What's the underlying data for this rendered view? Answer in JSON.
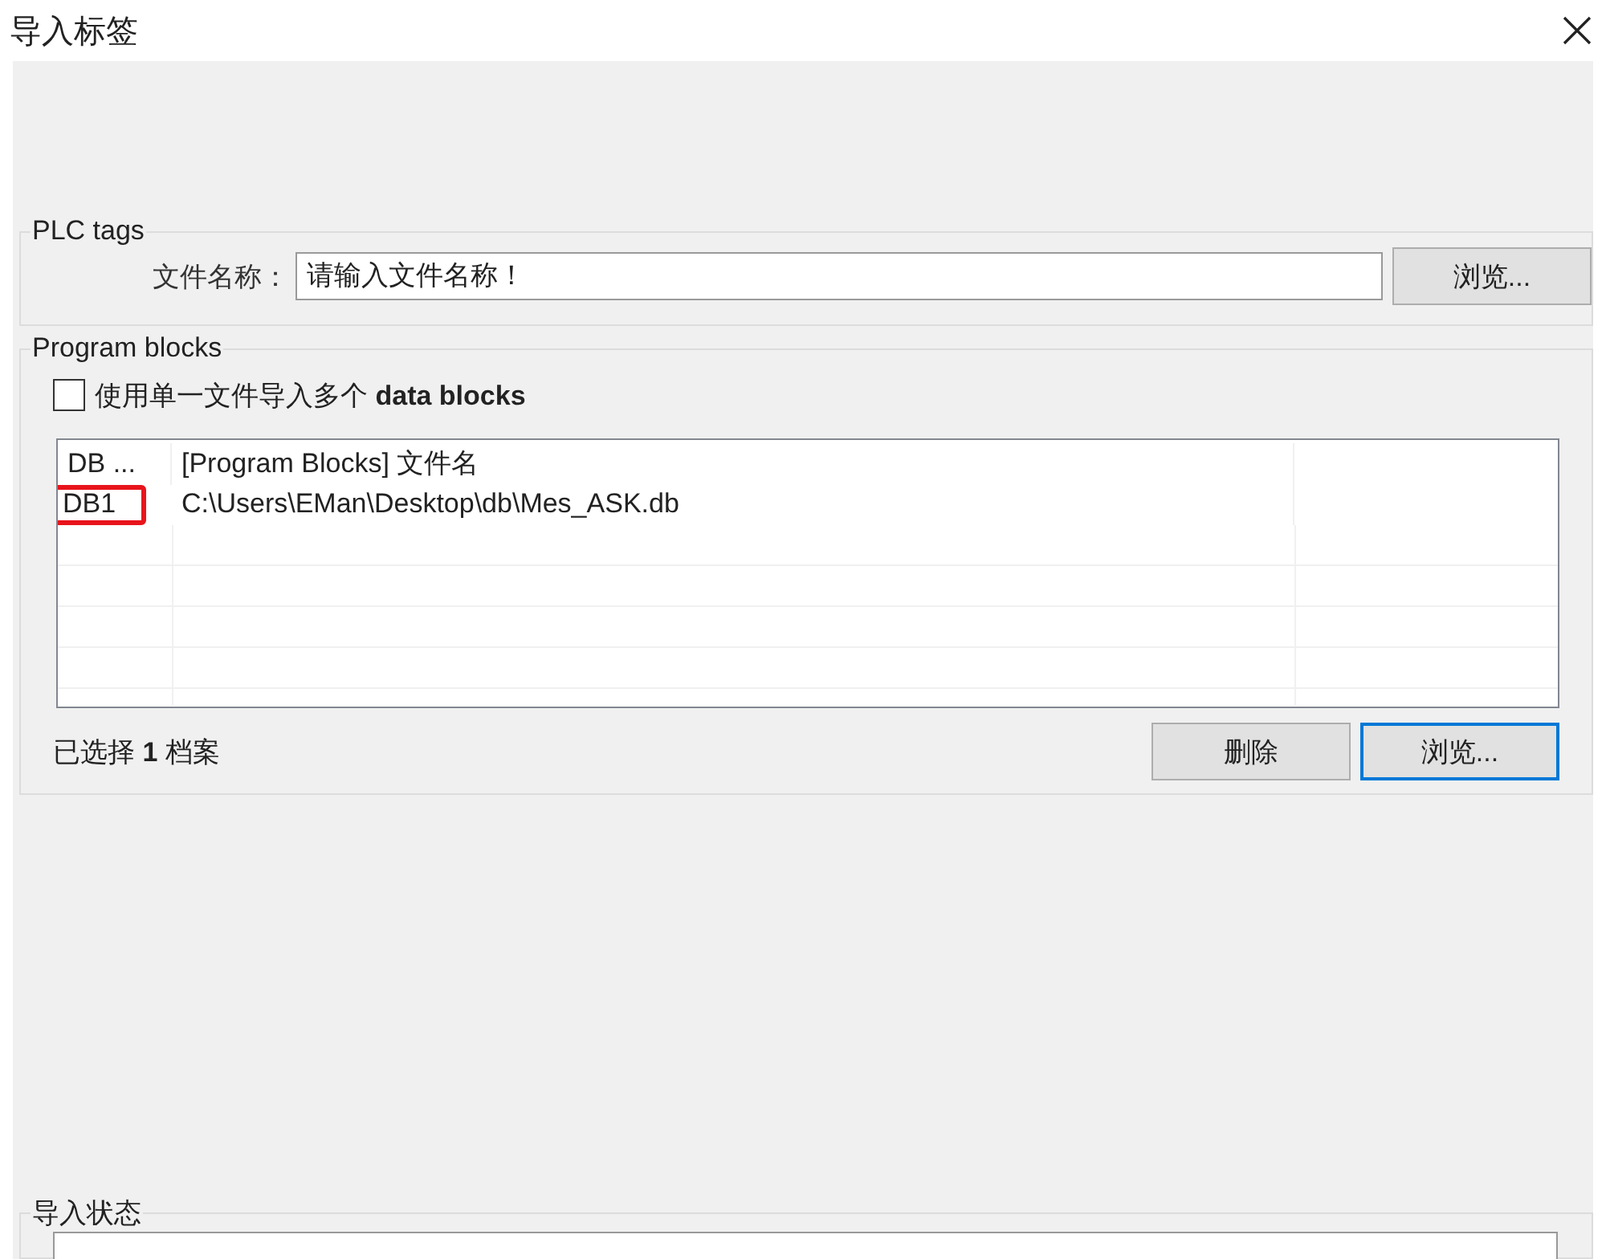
{
  "window": {
    "title": "导入标签"
  },
  "plc_tags": {
    "legend": "PLC tags",
    "file_label": "文件名称：",
    "file_field": {
      "placeholder": "请输入文件名称！"
    },
    "browse_button": {
      "label": "浏览...",
      "focused": false
    }
  },
  "program_blocks": {
    "legend": "Program blocks",
    "single_file_checkbox": {
      "label": "使用单一文件导入多个 **data blocks**",
      "checked": false
    },
    "table": {
      "columns": [
        "DB ...",
        "[Program Blocks] 文件名"
      ],
      "rows": [
        {
          "cells": [
            "DB1",
            "C:\\Users\\EMan\\Desktop\\db\\Mes_ASK.db"
          ],
          "highlighted": true
        }
      ]
    },
    "selection_count": "已选择 **1** 档案",
    "buttons": [
      {
        "label": "删除",
        "focused": false
      },
      {
        "label": "浏览...",
        "focused": true
      }
    ]
  },
  "import_status": {
    "legend": "导入状态"
  }
}
